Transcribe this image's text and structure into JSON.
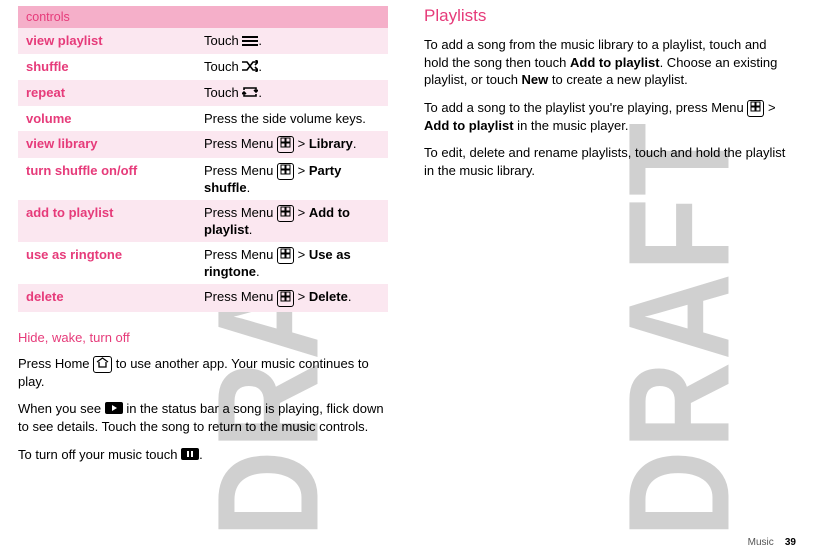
{
  "watermark": "DRAFT",
  "controls_header": "controls",
  "rows": [
    {
      "label": "view playlist",
      "pre": "Touch ",
      "icon": "list-icon",
      "post": "."
    },
    {
      "label": "shuffle",
      "pre": "Touch ",
      "icon": "shuffle-icon",
      "post": "."
    },
    {
      "label": "repeat",
      "pre": "Touch ",
      "icon": "repeat-icon",
      "post": "."
    },
    {
      "label": "volume",
      "pre": "Press the side volume keys.",
      "icon": "",
      "post": ""
    },
    {
      "label": "view library",
      "pre": "Press Menu ",
      "icon": "menu-key",
      "post": " > ",
      "bold": "Library",
      "tail": "."
    },
    {
      "label": "turn shuffle on/off",
      "pre": "Press Menu ",
      "icon": "menu-key",
      "post": " > ",
      "bold": "Party shuffle",
      "tail": "."
    },
    {
      "label": "add to playlist",
      "pre": "Press Menu ",
      "icon": "menu-key",
      "post": " > ",
      "bold": "Add to playlist",
      "tail": "."
    },
    {
      "label": "use as ringtone",
      "pre": "Press Menu ",
      "icon": "menu-key",
      "post": " > ",
      "bold": "Use as ringtone",
      "tail": "."
    },
    {
      "label": "delete",
      "pre": "Press Menu ",
      "icon": "menu-key",
      "post": " > ",
      "bold": "Delete",
      "tail": "."
    }
  ],
  "hide_heading": "Hide, wake, turn off",
  "hide_p1a": "Press Home ",
  "hide_p1b": " to use another app. Your music continues to play.",
  "hide_p2a": "When you see ",
  "hide_p2b": " in the status bar a song is playing, flick down to see details. Touch the song to return to the music controls.",
  "hide_p3a": "To turn off your music touch ",
  "hide_p3b": ".",
  "playlists_heading": "Playlists",
  "pl_p1a": "To add a song from the music library to a playlist, touch and hold the song then touch ",
  "pl_p1_b1": "Add to playlist",
  "pl_p1b": ". Choose an existing playlist, or touch ",
  "pl_p1_b2": "New",
  "pl_p1c": " to create a new playlist.",
  "pl_p2a": "To add a song to the playlist you're playing, press Menu ",
  "pl_p2b": " > ",
  "pl_p2_b1": "Add to playlist",
  "pl_p2c": " in the music player.",
  "pl_p3": "To edit, delete and rename playlists, touch and hold the playlist in the music library.",
  "footer_label": "Music",
  "footer_page": "39"
}
